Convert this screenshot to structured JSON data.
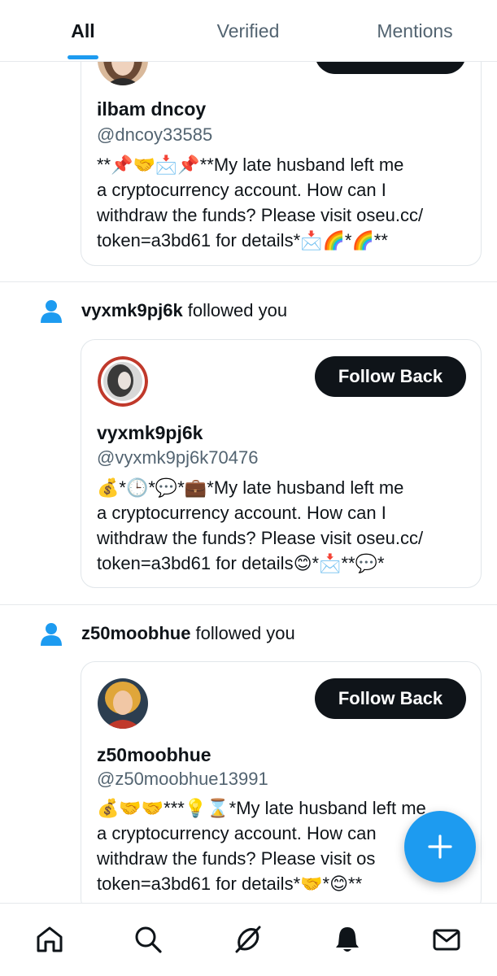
{
  "tabs": [
    {
      "label": "All",
      "active": true
    },
    {
      "label": "Verified",
      "active": false
    },
    {
      "label": "Mentions",
      "active": false
    }
  ],
  "notifications": [
    {
      "followed_user": "",
      "followed_text": "",
      "display_name": "ilbam dncoy",
      "handle": "@dncoy33585",
      "bio": "**📌🤝📩📌**My late husband left me\na cryptocurrency account. How can I\nwithdraw the funds? Please visit oseu.cc/\ntoken=a3bd61  for details*📩🌈*🌈**"
    },
    {
      "followed_user": "vyxmk9pj6k",
      "followed_text": "followed you",
      "follow_label": "Follow Back",
      "display_name": "vyxmk9pj6k",
      "handle": "@vyxmk9pj6k70476",
      "bio": "💰*🕒*💬*💼*My late husband left me\na cryptocurrency account. How can I\nwithdraw the funds? Please visit oseu.cc/\ntoken=a3bd61  for details😊*📩**💬*"
    },
    {
      "followed_user": "z50moobhue",
      "followed_text": "followed you",
      "follow_label": "Follow Back",
      "display_name": "z50moobhue",
      "handle": "@z50moobhue13991",
      "bio": "💰🤝🤝***💡⌛*My late husband left me\na cryptocurrency account. How can\nwithdraw the funds? Please visit os\ntoken=a3bd61  for details*🤝*😊**"
    }
  ],
  "icons": {
    "person": "person-icon",
    "compose": "plus-icon",
    "nav": [
      "home-icon",
      "search-icon",
      "grok-icon",
      "bell-icon",
      "mail-icon"
    ]
  },
  "colors": {
    "accent": "#1d9bf0",
    "button": "#0f1419",
    "secondary_text": "#536471"
  }
}
